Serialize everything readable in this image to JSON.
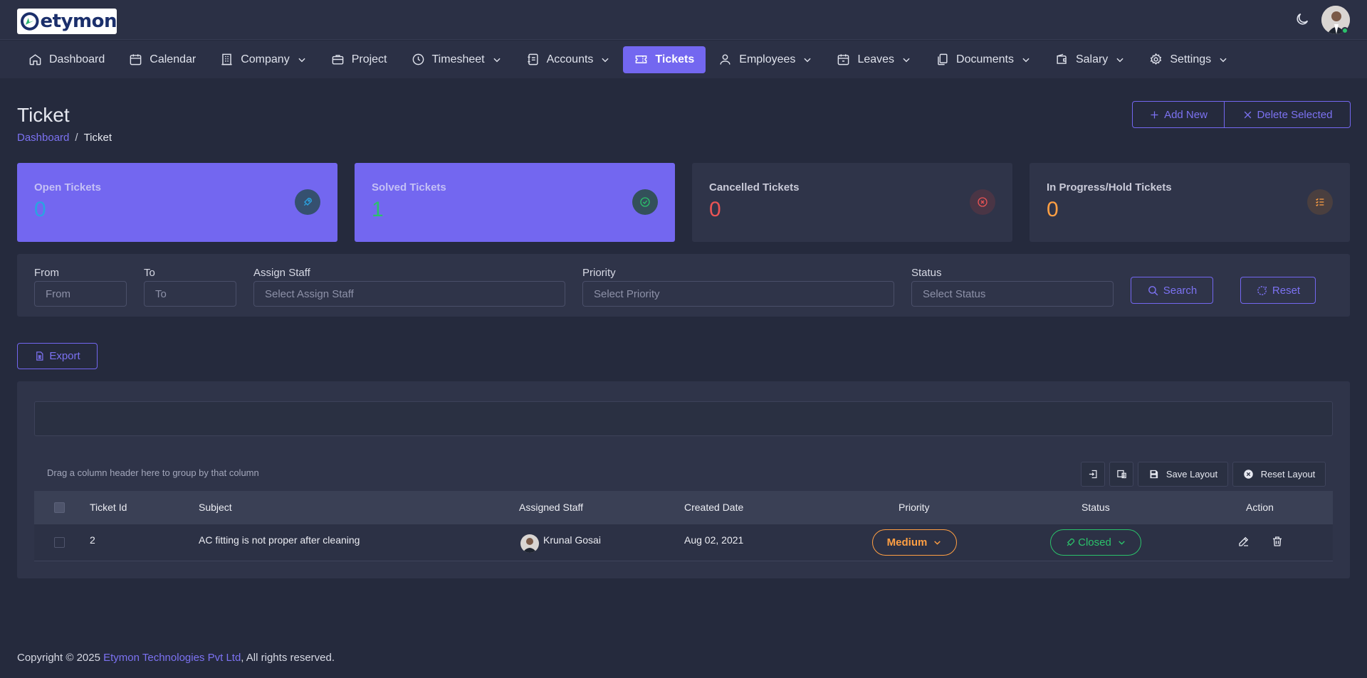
{
  "brand": {
    "name": "etymon"
  },
  "nav": [
    {
      "label": "Dashboard",
      "icon": "home-icon",
      "dropdown": false,
      "active": false
    },
    {
      "label": "Calendar",
      "icon": "calendar-icon",
      "dropdown": false,
      "active": false
    },
    {
      "label": "Company",
      "icon": "building-icon",
      "dropdown": true,
      "active": false
    },
    {
      "label": "Project",
      "icon": "briefcase-icon",
      "dropdown": false,
      "active": false
    },
    {
      "label": "Timesheet",
      "icon": "clock-icon",
      "dropdown": true,
      "active": false
    },
    {
      "label": "Accounts",
      "icon": "ledger-icon",
      "dropdown": true,
      "active": false
    },
    {
      "label": "Tickets",
      "icon": "ticket-icon",
      "dropdown": false,
      "active": true
    },
    {
      "label": "Employees",
      "icon": "user-icon",
      "dropdown": true,
      "active": false
    },
    {
      "label": "Leaves",
      "icon": "calendar-leave-icon",
      "dropdown": true,
      "active": false
    },
    {
      "label": "Documents",
      "icon": "documents-icon",
      "dropdown": true,
      "active": false
    },
    {
      "label": "Salary",
      "icon": "wallet-icon",
      "dropdown": true,
      "active": false
    },
    {
      "label": "Settings",
      "icon": "gear-icon",
      "dropdown": true,
      "active": false
    }
  ],
  "page": {
    "title": "Ticket",
    "breadcrumb": {
      "home": "Dashboard",
      "separator": "/",
      "current": "Ticket"
    },
    "add_new": "Add New",
    "delete_selected": "Delete Selected"
  },
  "stats": {
    "open": {
      "title": "Open Tickets",
      "value": "0",
      "color": "#2aa3e2"
    },
    "solved": {
      "title": "Solved Tickets",
      "value": "1",
      "color": "#2bc26b"
    },
    "cancelled": {
      "title": "Cancelled Tickets",
      "value": "0",
      "color": "#ea5455"
    },
    "progress": {
      "title": "In Progress/Hold Tickets",
      "value": "0",
      "color": "#ff9f43"
    }
  },
  "filters": {
    "from": {
      "label": "From",
      "placeholder": "From"
    },
    "to": {
      "label": "To",
      "placeholder": "To"
    },
    "staff": {
      "label": "Assign Staff",
      "placeholder": "Select Assign Staff"
    },
    "priority": {
      "label": "Priority",
      "placeholder": "Select Priority"
    },
    "status": {
      "label": "Status",
      "placeholder": "Select Status"
    },
    "search": "Search",
    "reset": "Reset"
  },
  "export": "Export",
  "grid": {
    "group_hint": "Drag a column header here to group by that column",
    "save_layout": "Save Layout",
    "reset_layout": "Reset Layout",
    "columns": [
      "Ticket Id",
      "Subject",
      "Assigned Staff",
      "Created Date",
      "Priority",
      "Status",
      "Action"
    ],
    "rows": [
      {
        "id": "2",
        "subject": "AC fitting is not proper after cleaning",
        "staff": "Krunal Gosai",
        "created": "Aug 02, 2021",
        "priority": "Medium",
        "status": "Closed"
      }
    ]
  },
  "footer": {
    "prefix": "Copyright © 2025 ",
    "company": "Etymon Technologies Pvt Ltd",
    "suffix": ", All rights reserved."
  },
  "colors": {
    "accent": "#7367f0",
    "medium": "#ff9f43",
    "closed": "#2bc26b"
  }
}
